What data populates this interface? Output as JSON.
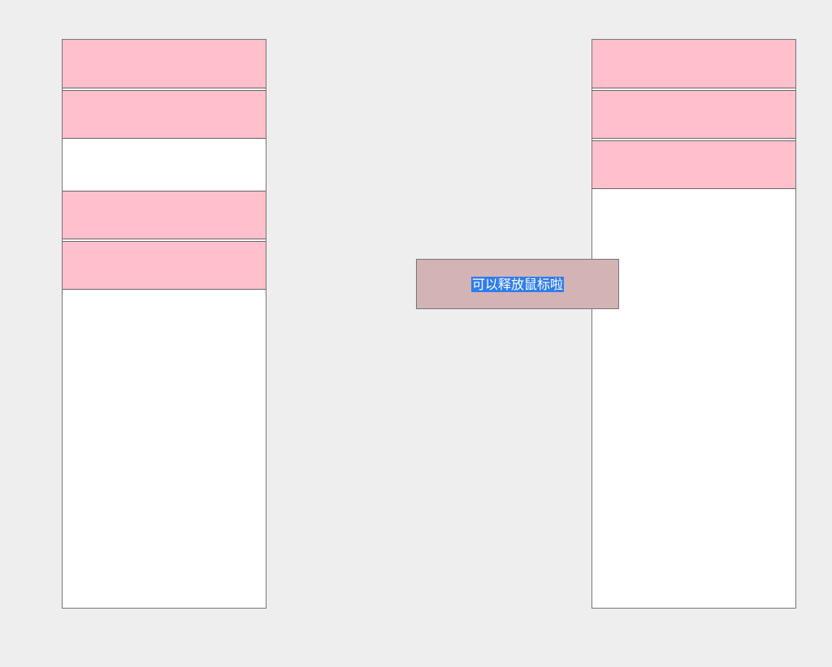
{
  "drag_ghost": {
    "label": "可以释放鼠标啦"
  },
  "colors": {
    "background": "#eeeeee",
    "column_background": "#ffffff",
    "item_fill": "#ffc0cb",
    "item_border": "#666666",
    "ghost_fill": "#d4b3b5",
    "text_selection": "#2f7df0"
  }
}
